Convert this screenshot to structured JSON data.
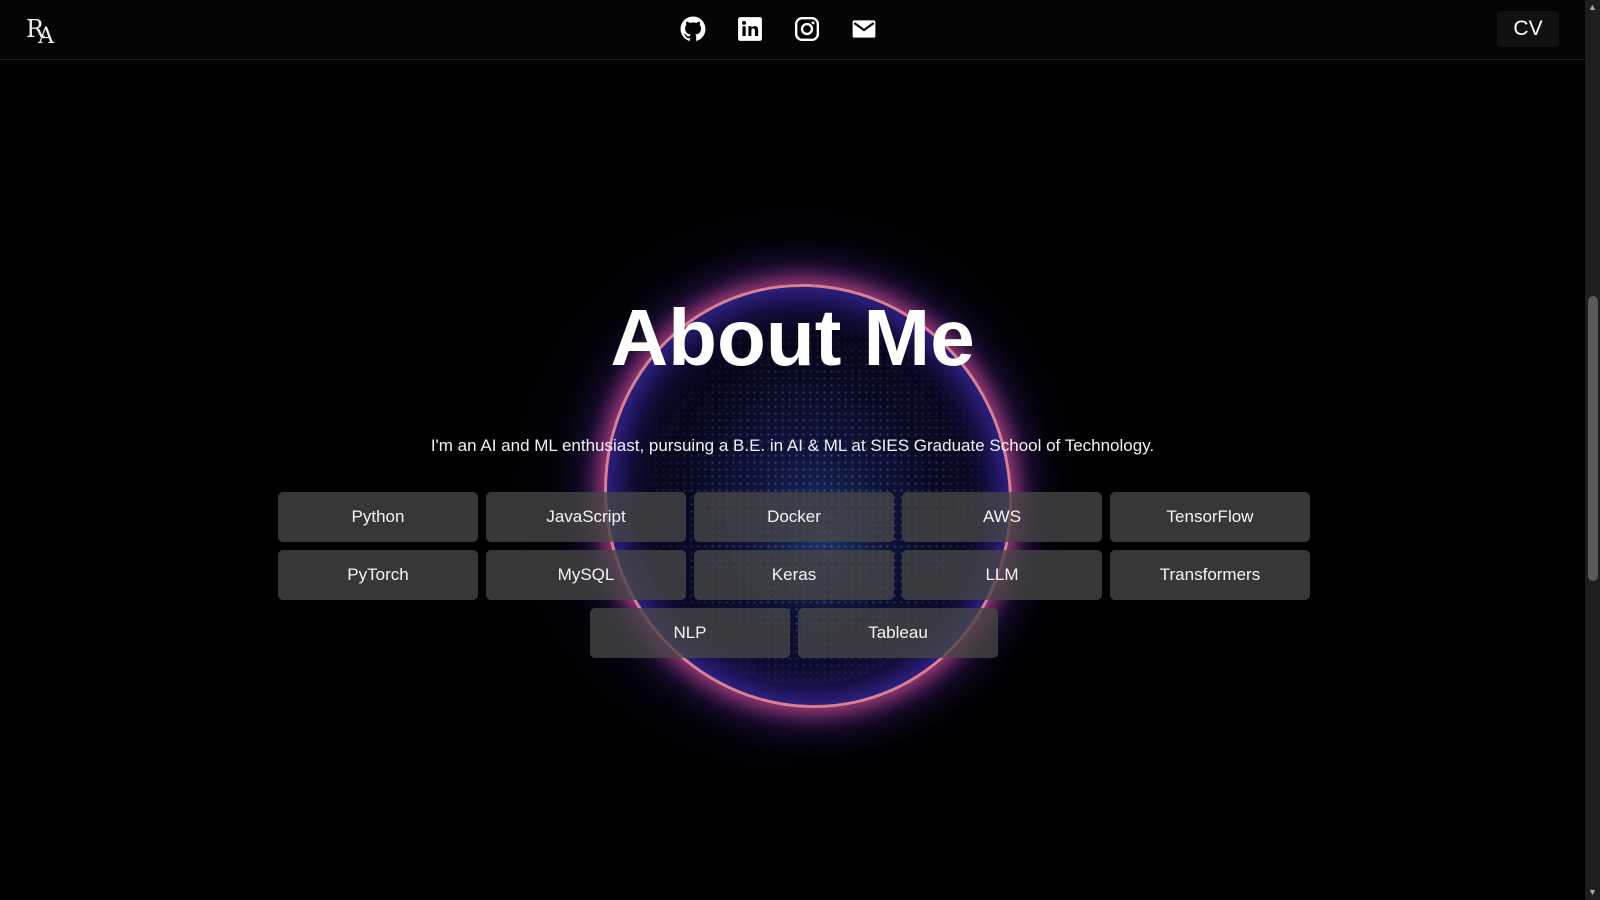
{
  "nav": {
    "logo": {
      "line1": "R",
      "line2": "A"
    },
    "socials": [
      {
        "icon": "github-icon"
      },
      {
        "icon": "linkedin-icon"
      },
      {
        "icon": "instagram-icon"
      },
      {
        "icon": "mail-icon"
      }
    ],
    "cv_label": "CV"
  },
  "about": {
    "title": "About Me",
    "intro": "I'm an AI and ML enthusiast, pursuing a B.E. in AI & ML at SIES Graduate School of Technology.",
    "skills": [
      "Python",
      "JavaScript",
      "Docker",
      "AWS",
      "TensorFlow",
      "PyTorch",
      "MySQL",
      "Keras",
      "LLM",
      "Transformers",
      "NLP",
      "Tableau"
    ]
  },
  "colors": {
    "background": "#000000",
    "skill_bg": "#464646",
    "ring_pink": "#ff96aa",
    "ring_blue": "#5a3ce6"
  }
}
